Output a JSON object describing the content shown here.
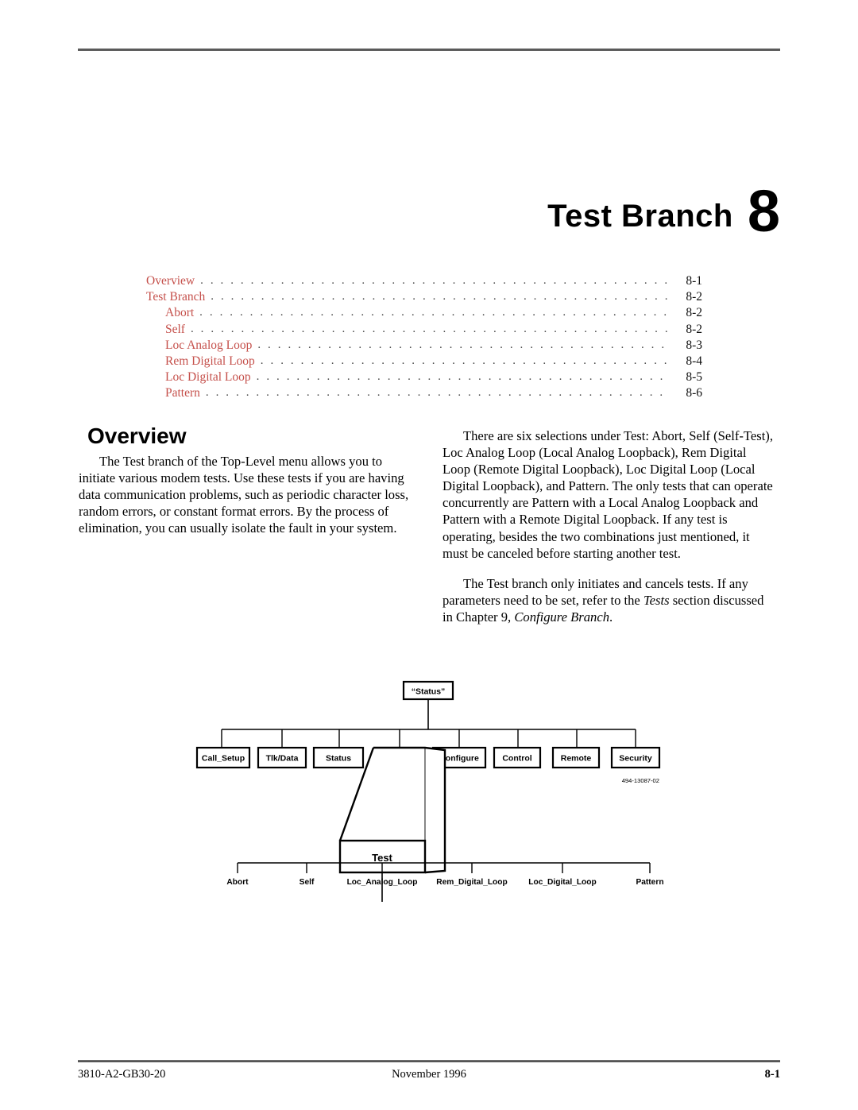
{
  "chapter": {
    "title": "Test Branch",
    "number": "8"
  },
  "toc": {
    "entries": [
      {
        "label": "Overview",
        "page": "8-1",
        "indent": false
      },
      {
        "label": "Test Branch",
        "page": "8-2",
        "indent": false
      },
      {
        "label": "Abort",
        "page": "8-2",
        "indent": true
      },
      {
        "label": "Self",
        "page": "8-2",
        "indent": true
      },
      {
        "label": "Loc Analog Loop",
        "page": "8-3",
        "indent": true
      },
      {
        "label": "Rem Digital Loop",
        "page": "8-4",
        "indent": true
      },
      {
        "label": "Loc Digital Loop",
        "page": "8-5",
        "indent": true
      },
      {
        "label": "Pattern",
        "page": "8-6",
        "indent": true
      }
    ],
    "leader_dots": ". . . . . . . . . . . . . . . . . . . . . . . . . . . . . . . . . . . . . . . . . . . . . . . . . . . . . . . . . . . . . . . . . . . . . . . . . . . . . . . . . . . . . . . . . . . . . . . . . . . . . . . . . . . . . . . . . .",
    "link_color": "#c5504b"
  },
  "section": {
    "heading": "Overview"
  },
  "body": {
    "left_paragraph_1": "The Test branch of the Top-Level menu allows you to initiate various modem tests. Use these tests if you are having data communication problems, such as periodic character loss, random errors, or constant format errors. By the process of elimination, you can usually isolate the fault in your system.",
    "right_paragraph_1": "There are six selections under Test: Abort, Self (Self-Test), Loc Analog Loop (Local Analog Loopback), Rem Digital Loop (Remote Digital Loopback), Loc Digital Loop (Local Digital Loopback), and Pattern. The only tests that can operate concurrently are Pattern with a Local Analog Loopback and Pattern with a Remote Digital Loopback. If any test is operating, besides the two combinations just mentioned, it must be canceled before starting another test.",
    "right_paragraph_2_a": "The Test branch only initiates and cancels tests. If any parameters need to be set, refer to the ",
    "right_paragraph_2_italic_1": "Tests",
    "right_paragraph_2_b": " section discussed in Chapter 9, ",
    "right_paragraph_2_italic_2": "Configure Branch",
    "right_paragraph_2_c": "."
  },
  "diagram": {
    "root_label": "“Status”",
    "level1": [
      "Call_Setup",
      "Tlk/Data",
      "Status",
      "Configure",
      "Control",
      "Remote",
      "Security"
    ],
    "highlighted_box": "Test",
    "leaves": [
      "Abort",
      "Self",
      "Loc_Analog_Loop",
      "Rem_Digital_Loop",
      "Loc_Digital_Loop",
      "Pattern"
    ],
    "reference_code": "494-13087-02"
  },
  "footer": {
    "left": "3810-A2-GB30-20",
    "center": "November 1996",
    "right": "8-1"
  }
}
